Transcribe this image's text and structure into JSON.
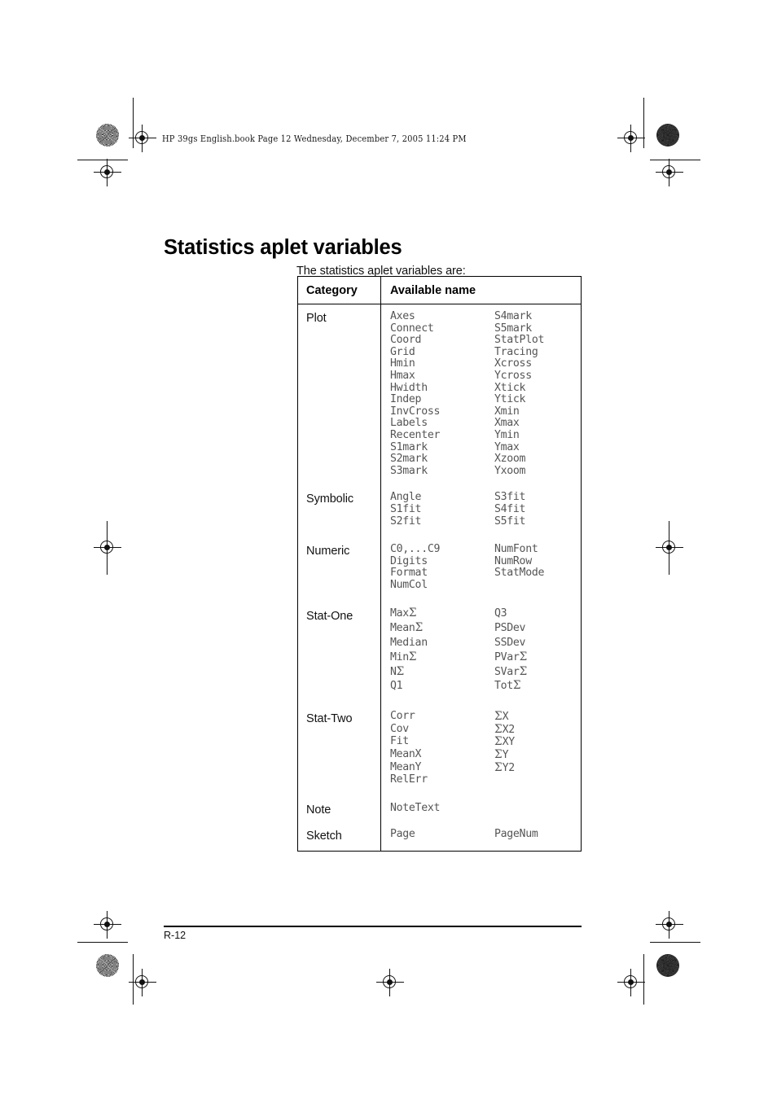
{
  "book_header": "HP 39gs English.book  Page 12  Wednesday, December 7, 2005  11:24 PM",
  "page": {
    "title": "Statistics aplet variables",
    "intro": "The statistics aplet variables are:",
    "folio": "R-12"
  },
  "table": {
    "headers": {
      "category": "Category",
      "available_name": "Available name"
    },
    "rows": [
      {
        "category": "Plot",
        "names": [
          "Axes",
          "S4mark",
          "Connect",
          "S5mark",
          "Coord",
          "StatPlot",
          "Grid",
          "Tracing",
          "Hmin",
          "Xcross",
          "Hmax",
          "Ycross",
          "Hwidth",
          "Xtick",
          "Indep",
          "Ytick",
          "InvCross",
          "Xmin",
          "Labels",
          "Xmax",
          "Recenter",
          "Ymin",
          "S1mark",
          "Ymax",
          "S2mark",
          "Xzoom",
          "S3mark",
          "Yxoom"
        ]
      },
      {
        "category": "Symbolic",
        "names": [
          "Angle",
          "S3fit",
          "S1fit",
          "S4fit",
          "S2fit",
          "S5fit"
        ]
      },
      {
        "category": "Numeric",
        "names": [
          "C0,...C9",
          "NumFont",
          "Digits",
          "NumRow",
          "Format",
          "StatMode",
          "NumCol",
          ""
        ]
      },
      {
        "category": "Stat-One",
        "names": [
          "MaxΣ",
          "Q3",
          "MeanΣ",
          "PSDev",
          "Median",
          "SSDev",
          "MinΣ",
          "PVarΣ",
          "NΣ",
          "SVarΣ",
          "Q1",
          "TotΣ"
        ]
      },
      {
        "category": "Stat-Two",
        "names": [
          "Corr",
          "ΣX",
          "Cov",
          "ΣX2",
          "Fit",
          "ΣXY",
          "MeanX",
          "ΣY",
          "MeanY",
          "ΣY2",
          "RelErr",
          ""
        ]
      },
      {
        "category": "Note",
        "names": [
          "NoteText",
          ""
        ]
      },
      {
        "category": "Sketch",
        "names": [
          "Page",
          "PageNum"
        ]
      }
    ]
  }
}
